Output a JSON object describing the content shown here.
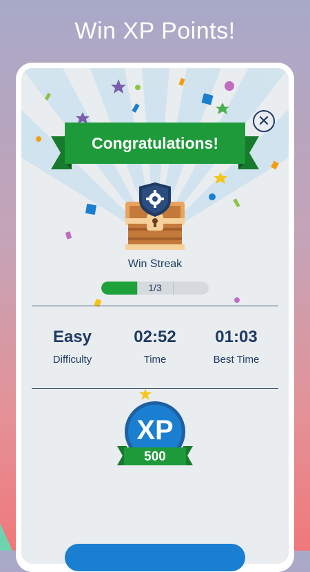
{
  "promo": {
    "headline": "Win XP Points!"
  },
  "dialog": {
    "banner_title": "Congratulations!",
    "reward_label": "Win Streak",
    "streak_progress": {
      "current": 1,
      "total": 3,
      "text": "1/3"
    },
    "stats": [
      {
        "value": "Easy",
        "label": "Difficulty"
      },
      {
        "value": "02:52",
        "label": "Time"
      },
      {
        "value": "01:03",
        "label": "Best Time"
      }
    ],
    "xp": {
      "badge_text": "XP",
      "amount": "500"
    }
  },
  "colors": {
    "banner_green": "#1e9a3a",
    "navy_text": "#1f3a63",
    "xp_blue": "#1a7fd0",
    "progress_green": "#1fa13a"
  }
}
